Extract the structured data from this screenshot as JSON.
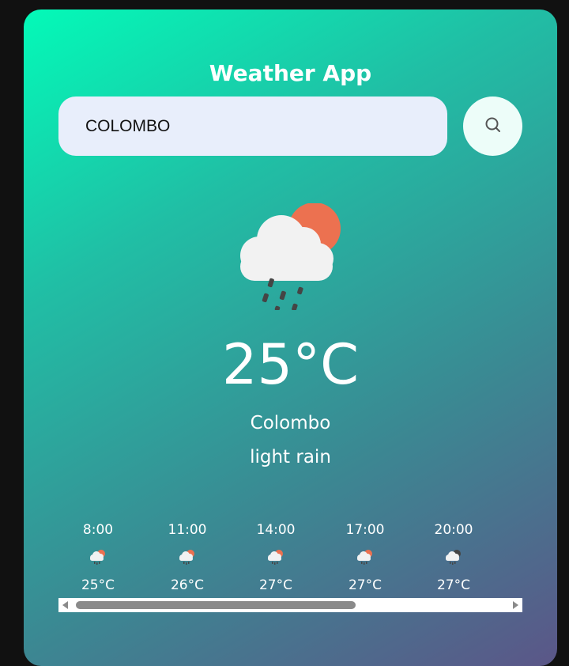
{
  "app": {
    "title": "Weather App"
  },
  "search": {
    "value": "COLOMBO",
    "button_icon": "search-icon"
  },
  "current": {
    "icon": "rain-cloud-sun-icon",
    "temperature": "25°C",
    "city": "Colombo",
    "description": "light rain"
  },
  "forecast": [
    {
      "time": "8:00",
      "icon": "rain-cloud-sun-icon",
      "temp": "25°C"
    },
    {
      "time": "11:00",
      "icon": "rain-cloud-sun-icon",
      "temp": "26°C"
    },
    {
      "time": "14:00",
      "icon": "rain-cloud-sun-icon",
      "temp": "27°C"
    },
    {
      "time": "17:00",
      "icon": "rain-cloud-sun-icon",
      "temp": "27°C"
    },
    {
      "time": "20:00",
      "icon": "rain-cloud-moon-icon",
      "temp": "27°C"
    }
  ],
  "colors": {
    "gradient_start": "#03fab8",
    "gradient_end": "#5b5688",
    "sun": "#ec7150",
    "cloud": "#f2f2f2",
    "search_bg": "#e8eefb"
  }
}
